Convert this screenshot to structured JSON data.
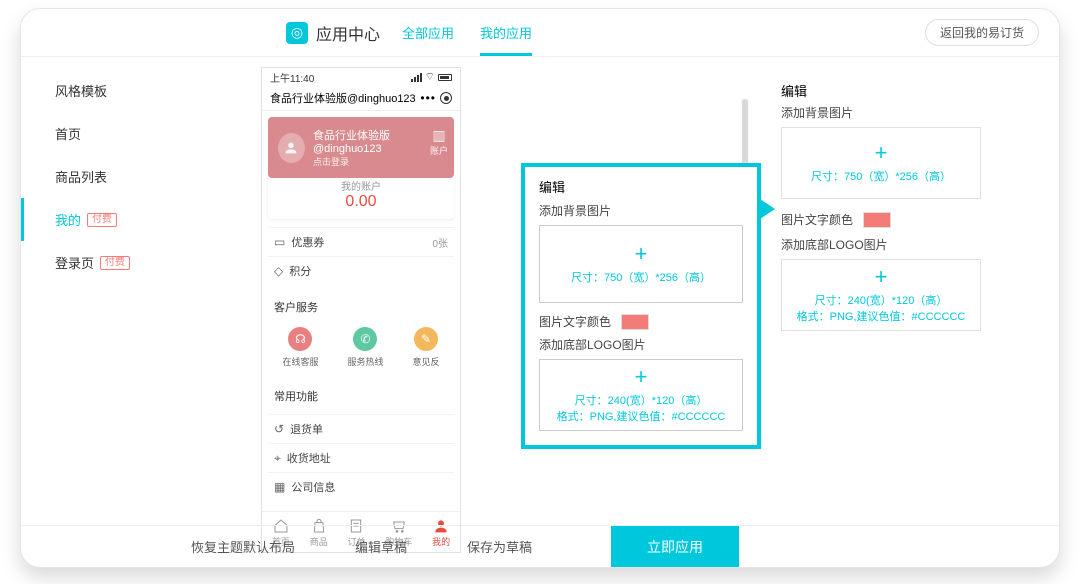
{
  "header": {
    "brand": "应用中心",
    "tabs": {
      "all": "全部应用",
      "mine": "我的应用"
    },
    "back": "返回我的易订货"
  },
  "sidebar": {
    "items": [
      {
        "label": "风格模板",
        "active": false,
        "pay": false
      },
      {
        "label": "首页",
        "active": false,
        "pay": false
      },
      {
        "label": "商品列表",
        "active": false,
        "pay": false
      },
      {
        "label": "我的",
        "active": true,
        "pay": true
      },
      {
        "label": "登录页",
        "active": false,
        "pay": true
      }
    ],
    "pay_badge": "付费"
  },
  "phone": {
    "status_time": "上午11:40",
    "top_title": "食品行业体验版@dinghuo123",
    "hero_title": "食品行业体验版@dinghuo123",
    "hero_sub": "点击登录",
    "hero_right": "账户",
    "account_title": "我的账户",
    "account_amount": "0.00",
    "coupon_label": "优惠券",
    "coupon_count": "0张",
    "points_label": "积分",
    "service_title": "客户服务",
    "services": [
      "在线客服",
      "服务热线",
      "意见反"
    ],
    "common_title": "常用功能",
    "common_items": [
      "退货单",
      "收货地址",
      "公司信息"
    ],
    "tabs": [
      "首页",
      "商品",
      "订单",
      "购物车",
      "我的"
    ]
  },
  "callout": {
    "title": "编辑",
    "bg_label": "添加背景图片",
    "bg_hint": "尺寸：750（宽）*256（高）",
    "text_color_label": "图片文字颜色",
    "logo_label": "添加底部LOGO图片",
    "logo_hint1": "尺寸：240(宽）*120（高）",
    "logo_hint2": "格式：PNG,建议色值：#CCCCCC"
  },
  "right": {
    "title": "编辑",
    "bg_label": "添加背景图片",
    "bg_hint": "尺寸：750（宽）*256（高）",
    "text_color_label": "图片文字颜色",
    "logo_label": "添加底部LOGO图片",
    "logo_hint1": "尺寸：240(宽）*120（高）",
    "logo_hint2": "格式：PNG,建议色值：#CCCCCC"
  },
  "footer": {
    "restore": "恢复主题默认布局",
    "edit_draft": "编辑草稿",
    "save_draft": "保存为草稿",
    "apply": "立即应用"
  },
  "colors": {
    "accent": "#00c8dc",
    "swatch": "#f37b78"
  }
}
